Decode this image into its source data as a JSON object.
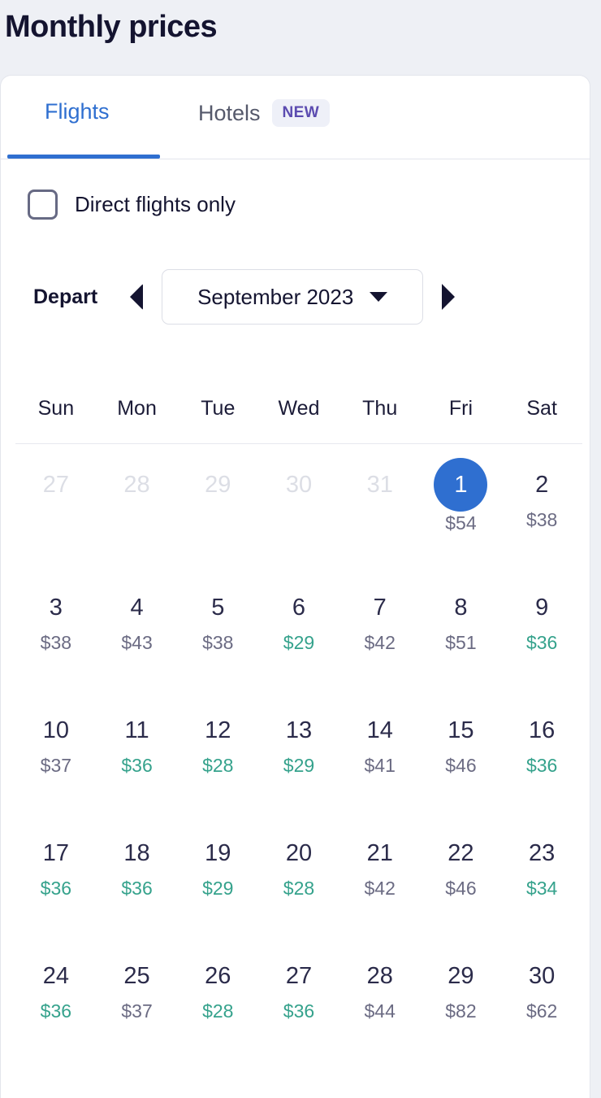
{
  "header": {
    "title": "Monthly prices"
  },
  "tabs": {
    "flights": {
      "label": "Flights"
    },
    "hotels": {
      "label": "Hotels",
      "badge": "NEW"
    }
  },
  "filters": {
    "direct_only": {
      "label": "Direct flights only",
      "checked": false
    }
  },
  "month_selector": {
    "depart_label": "Depart",
    "prev_icon": "triangle-left-icon",
    "next_icon": "triangle-right-icon",
    "selected_month": "September 2023",
    "caret_icon": "caret-down-icon"
  },
  "calendar": {
    "weekdays": [
      "Sun",
      "Mon",
      "Tue",
      "Wed",
      "Thu",
      "Fri",
      "Sat"
    ],
    "currency": "$",
    "weeks": [
      [
        {
          "day": "27",
          "price": "",
          "muted": true,
          "cheap": false,
          "selected": false
        },
        {
          "day": "28",
          "price": "",
          "muted": true,
          "cheap": false,
          "selected": false
        },
        {
          "day": "29",
          "price": "",
          "muted": true,
          "cheap": false,
          "selected": false
        },
        {
          "day": "30",
          "price": "",
          "muted": true,
          "cheap": false,
          "selected": false
        },
        {
          "day": "31",
          "price": "",
          "muted": true,
          "cheap": false,
          "selected": false
        },
        {
          "day": "1",
          "price": "$54",
          "muted": false,
          "cheap": false,
          "selected": true
        },
        {
          "day": "2",
          "price": "$38",
          "muted": false,
          "cheap": false,
          "selected": false
        }
      ],
      [
        {
          "day": "3",
          "price": "$38",
          "muted": false,
          "cheap": false,
          "selected": false
        },
        {
          "day": "4",
          "price": "$43",
          "muted": false,
          "cheap": false,
          "selected": false
        },
        {
          "day": "5",
          "price": "$38",
          "muted": false,
          "cheap": false,
          "selected": false
        },
        {
          "day": "6",
          "price": "$29",
          "muted": false,
          "cheap": true,
          "selected": false
        },
        {
          "day": "7",
          "price": "$42",
          "muted": false,
          "cheap": false,
          "selected": false
        },
        {
          "day": "8",
          "price": "$51",
          "muted": false,
          "cheap": false,
          "selected": false
        },
        {
          "day": "9",
          "price": "$36",
          "muted": false,
          "cheap": true,
          "selected": false
        }
      ],
      [
        {
          "day": "10",
          "price": "$37",
          "muted": false,
          "cheap": false,
          "selected": false
        },
        {
          "day": "11",
          "price": "$36",
          "muted": false,
          "cheap": true,
          "selected": false
        },
        {
          "day": "12",
          "price": "$28",
          "muted": false,
          "cheap": true,
          "selected": false
        },
        {
          "day": "13",
          "price": "$29",
          "muted": false,
          "cheap": true,
          "selected": false
        },
        {
          "day": "14",
          "price": "$41",
          "muted": false,
          "cheap": false,
          "selected": false
        },
        {
          "day": "15",
          "price": "$46",
          "muted": false,
          "cheap": false,
          "selected": false
        },
        {
          "day": "16",
          "price": "$36",
          "muted": false,
          "cheap": true,
          "selected": false
        }
      ],
      [
        {
          "day": "17",
          "price": "$36",
          "muted": false,
          "cheap": true,
          "selected": false
        },
        {
          "day": "18",
          "price": "$36",
          "muted": false,
          "cheap": true,
          "selected": false
        },
        {
          "day": "19",
          "price": "$29",
          "muted": false,
          "cheap": true,
          "selected": false
        },
        {
          "day": "20",
          "price": "$28",
          "muted": false,
          "cheap": true,
          "selected": false
        },
        {
          "day": "21",
          "price": "$42",
          "muted": false,
          "cheap": false,
          "selected": false
        },
        {
          "day": "22",
          "price": "$46",
          "muted": false,
          "cheap": false,
          "selected": false
        },
        {
          "day": "23",
          "price": "$34",
          "muted": false,
          "cheap": true,
          "selected": false
        }
      ],
      [
        {
          "day": "24",
          "price": "$36",
          "muted": false,
          "cheap": true,
          "selected": false
        },
        {
          "day": "25",
          "price": "$37",
          "muted": false,
          "cheap": false,
          "selected": false
        },
        {
          "day": "26",
          "price": "$28",
          "muted": false,
          "cheap": true,
          "selected": false
        },
        {
          "day": "27",
          "price": "$36",
          "muted": false,
          "cheap": true,
          "selected": false
        },
        {
          "day": "28",
          "price": "$44",
          "muted": false,
          "cheap": false,
          "selected": false
        },
        {
          "day": "29",
          "price": "$82",
          "muted": false,
          "cheap": false,
          "selected": false
        },
        {
          "day": "30",
          "price": "$62",
          "muted": false,
          "cheap": false,
          "selected": false
        }
      ]
    ]
  },
  "colors": {
    "accent_blue": "#2f6fd0",
    "cheap_green": "#35a28c",
    "price_gray": "#6b6b83",
    "text_dark": "#141430",
    "muted_day": "#dcdee5",
    "badge_purple": "#5b4bb0",
    "page_bg": "#eef0f5"
  }
}
